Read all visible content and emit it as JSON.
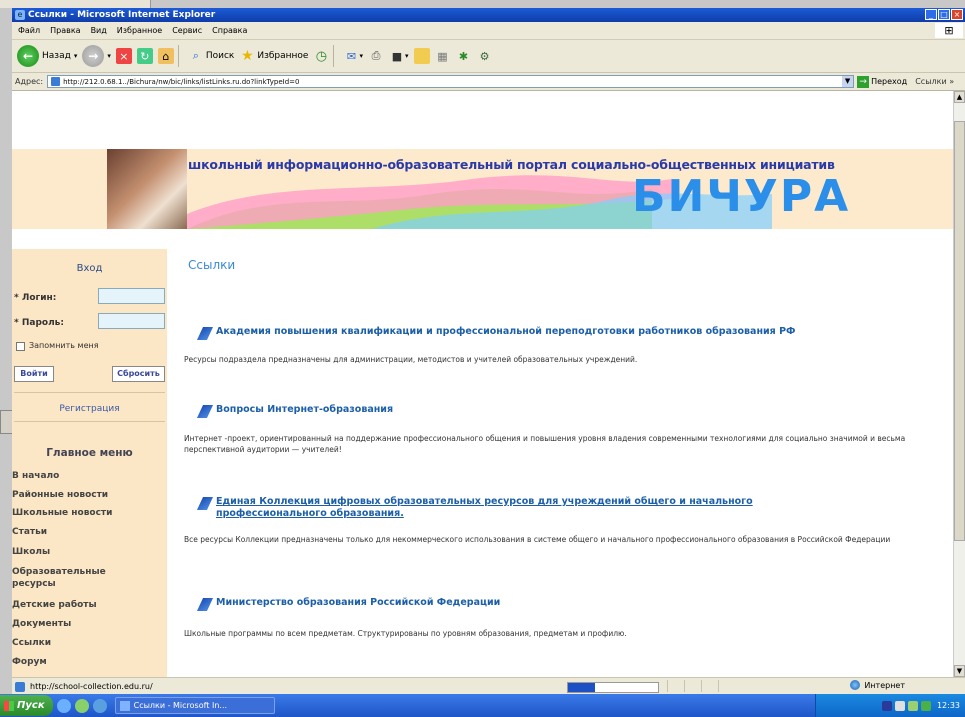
{
  "window": {
    "title": "Ссылки - Microsoft Internet Explorer"
  },
  "menubar": {
    "items": [
      "Файл",
      "Правка",
      "Вид",
      "Избранное",
      "Сервис",
      "Справка"
    ]
  },
  "toolbar": {
    "back_label": "Назад",
    "search_label": "Поиск",
    "favorites_label": "Избранное"
  },
  "addressbar": {
    "label": "Адрес:",
    "url": "http://212.0.68.1../Bichura/nw/bic/links/listLinks.ru.do?linkTypeId=0",
    "go_label": "Переход",
    "links_label": "Ссылки »"
  },
  "banner": {
    "tagline": "школьный информационно-образовательный портал социально-общественных инициатив",
    "title": "БИЧУРА"
  },
  "login": {
    "title": "Вход",
    "login_label": "* Логин:",
    "password_label": "* Пароль:",
    "remember_label": "Запомнить меня",
    "enter_button": "Войти",
    "reset_button": "Сбросить",
    "register_link": "Регистрация"
  },
  "main_menu": {
    "title": "Главное меню",
    "items": [
      "В начало",
      "Районные новости",
      "Школьные новости",
      "Статьи",
      "Школы",
      "Образовательные ресурсы",
      "Детские работы",
      "Документы",
      "Ссылки",
      "Форум"
    ]
  },
  "content": {
    "page_title": "Ссылки",
    "links": [
      {
        "title": "Академия повышения квалификации и профессиональной переподготовки работников образования РФ",
        "description": "Ресурсы подраздела предназначены для администрации, методистов и учителей образовательных учреждений."
      },
      {
        "title": "Вопросы Интернет-образования",
        "description": "Интернет -проект, ориентированный на поддержание профессионального общения и повышения уровня владения современными технологиями для социально значимой и весьма перспективной аудитории — учителей!"
      },
      {
        "title": "Единая Коллекция цифровых образовательных ресурсов для учреждений общего и начального профессионального образования.",
        "description": "Все ресурсы Коллекции предназначены только для некоммерческого использования в системе общего и начального профессионального образования в Российской Федерации"
      },
      {
        "title": "Министерство образования Российской Федерации",
        "description": "Школьные программы по всем предметам. Структурированы по уровням образования, предметам и профилю."
      }
    ]
  },
  "statusbar": {
    "text": "http://school-collection.edu.ru/",
    "zone": "Интернет",
    "progress": 0.3
  },
  "taskbar": {
    "start_label": "Пуск",
    "task_label": "Ссылки - Microsoft In...",
    "clock": "12:33"
  },
  "icons": [
    "ie-icon",
    "back-arrow-icon",
    "forward-arrow-icon",
    "stop-icon",
    "refresh-icon",
    "home-icon",
    "search-icon",
    "favorites-star-icon",
    "history-icon",
    "mail-icon",
    "print-icon",
    "edit-icon",
    "messenger-icon",
    "pen-icon",
    "globe-icon",
    "windows-flag-icon"
  ],
  "colors": {
    "accent": "#2b8ee8",
    "link": "#1c5fa8",
    "sidebar": "#fbe6c5",
    "banner": "#fdeacc"
  }
}
